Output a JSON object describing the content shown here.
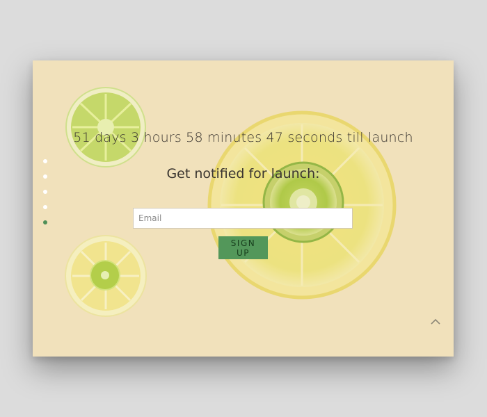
{
  "countdown": {
    "text": "51 days 3 hours 58 minutes 47 seconds till launch"
  },
  "notify": {
    "heading": "Get notified for launch:"
  },
  "form": {
    "email_placeholder": "Email",
    "email_value": "",
    "signup_label": "SIGN UP"
  },
  "slide_nav": {
    "count": 5,
    "active_index": 4
  },
  "icons": {
    "scroll_top": "chevron-up-icon"
  },
  "colors": {
    "background": "#f1e1bb",
    "accent": "#53975a",
    "active_dot": "#4f8f57"
  }
}
